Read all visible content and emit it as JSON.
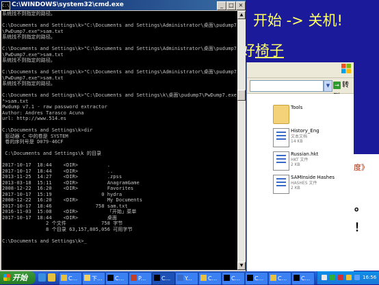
{
  "slide": {
    "title": "开始 -> 关机!",
    "subtitle_pre": "好",
    "subtitle_u": "椅子",
    "frag1": "度》",
    "frag2": "。",
    "frag3": "！"
  },
  "cmd": {
    "title": "C:\\WINDOWS\\system32\\cmd.exe",
    "icon_text": "C:\\",
    "min": "_",
    "max": "□",
    "close": "×",
    "console_lines": [
      "系统找不到指定的路径。",
      "",
      "C:\\Documents and Settings\\k>\"C:\\Documents and Settings\\Administrator\\桌面\\pudump7",
      "\\PwDump7.exe\">sam.txt",
      "系统找不到指定的路径。",
      "",
      "C:\\Documents and Settings\\k>\"C:\\Documents and Settings\\Administrator\\桌面\\pudump7",
      "\\PwDump7.exe\">sam.txt",
      "系统找不到指定的路径。",
      "",
      "C:\\Documents and Settings\\k>\"C:\\Documents and Settings\\Administrator\\桌面\\pudump7",
      "\\PwDump7.exe\">sam.txt",
      "系统找不到指定的路径。",
      "",
      "C:\\Documents and Settings\\k>\"C:\\Documents and Settings\\k\\桌面\\pudump7\\PwDump7.exe",
      "\">sam.txt",
      "Pwdump v7.1 - raw password extractor",
      "Author: Andres Tarasco Acuna",
      "url: http://www.514.es",
      "",
      "C:\\Documents and Settings\\k>dir",
      " 驱动器 C 中的卷是 SYSTEM",
      " 卷的序列号是 D079-46CF",
      "",
      " C:\\Documents and Settings\\k 的目录",
      "",
      "2017-10-17  18:44    <DIR>          .",
      "2017-10-17  18:44    <DIR>          ..",
      "2013-11-25  14:27    <DIR>          .zpss",
      "2013-03-18  15:11    <DIR>          AnagramGame",
      "2008-12-22  16:20    <DIR>          Favorites",
      "2017-10-17  15:19                 0 hydra",
      "2008-12-22  16:20    <DIR>          My Documents",
      "2017-10-17  18:46               758 sam.txt",
      "2016-11-03  15:08    <DIR>          「开始」菜单",
      "2017-10-17  18:44    <DIR>          桌面",
      "               2 个文件            758 字节",
      "               8 个目录 63,157,805,056 可用字节",
      "",
      "C:\\Documents and Settings\\k>_"
    ]
  },
  "explorer": {
    "go_label": "转到",
    "go_arrow": "→",
    "drop_arrow": "▼",
    "files": [
      {
        "name": "Tools",
        "line1": "",
        "line2": "",
        "icon": "folder-icon"
      },
      {
        "name": "History_Eng",
        "line1": "文本文档",
        "line2": "14 KB",
        "icon": "text-file-icon"
      },
      {
        "name": "Russian.hkt",
        "line1": "HKT 文件",
        "line2": "2 KB",
        "icon": "hkt-file-icon"
      },
      {
        "name": "SAMInside Hashes",
        "line1": "HASHES 文件",
        "line2": "2 KB",
        "icon": "hashes-file-icon"
      }
    ]
  },
  "taskbar": {
    "start_label": "开始",
    "tasks": [
      {
        "label": "C...",
        "icon_color": "#e8c040"
      },
      {
        "label": "下...",
        "icon_color": "#f0d060"
      },
      {
        "label": "C...",
        "icon_color": "#000000"
      },
      {
        "label": "P...",
        "icon_color": "#c0402a"
      },
      {
        "label": "C...",
        "icon_color": "#000000"
      },
      {
        "label": "Y...",
        "icon_color": "#3a6ac8"
      },
      {
        "label": "C...",
        "icon_color": "#e8c040"
      },
      {
        "label": "C...",
        "icon_color": "#000000"
      },
      {
        "label": "C...",
        "icon_color": "#000000"
      },
      {
        "label": "C...",
        "icon_color": "#e8c040"
      },
      {
        "label": "C...",
        "icon_color": "#000000"
      }
    ],
    "clock": "16:56",
    "colors": {
      "accent": "#245edb",
      "start": "#2f8a2f",
      "tray": "#0f8fe8"
    }
  }
}
